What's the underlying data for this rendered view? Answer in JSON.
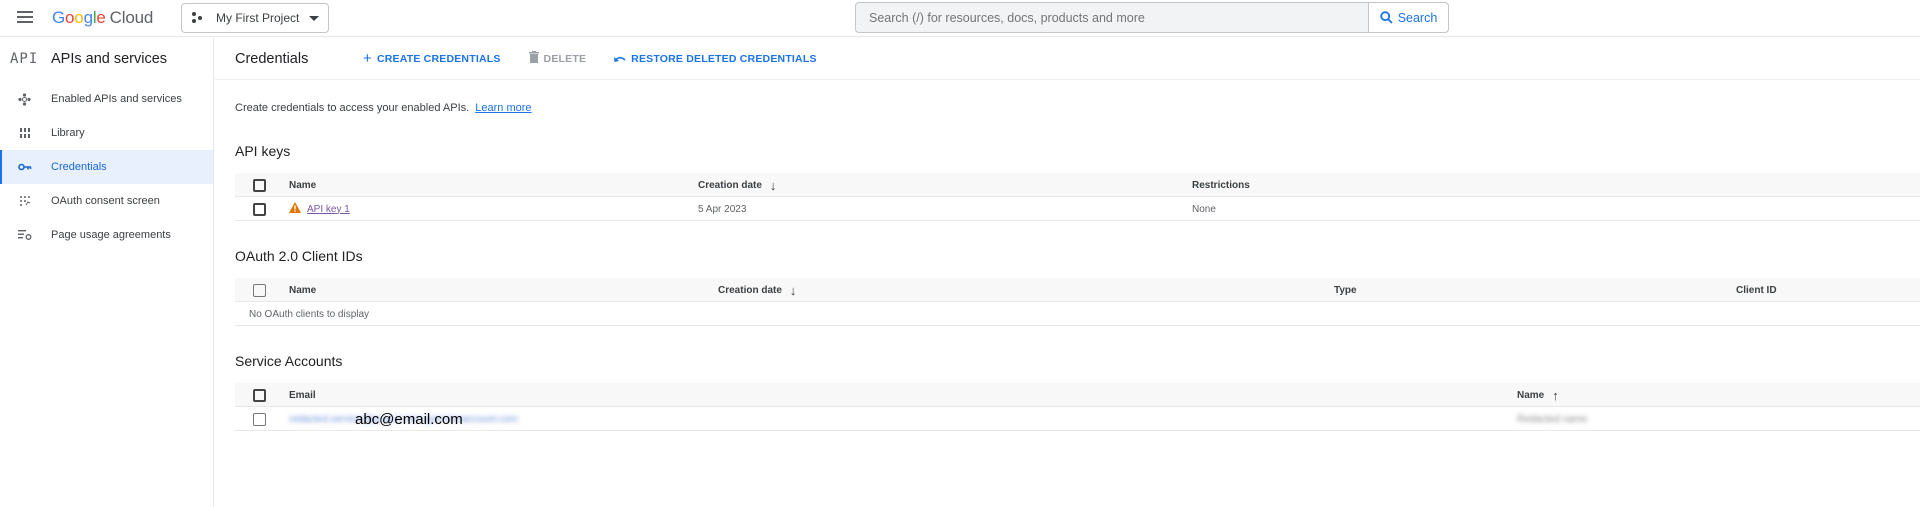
{
  "header": {
    "logo_letters": [
      "G",
      "o",
      "o",
      "g",
      "l",
      "e"
    ],
    "logo_product": "Cloud",
    "project_name": "My First Project",
    "search_placeholder": "Search (/) for resources, docs, products and more",
    "search_button": "Search"
  },
  "sidebar": {
    "badge": "API",
    "title": "APIs and services",
    "items": [
      {
        "label": "Enabled APIs and services",
        "icon": "enabled-apis-icon",
        "active": false
      },
      {
        "label": "Library",
        "icon": "library-icon",
        "active": false
      },
      {
        "label": "Credentials",
        "icon": "key-icon",
        "active": true
      },
      {
        "label": "OAuth consent screen",
        "icon": "oauth-consent-icon",
        "active": false
      },
      {
        "label": "Page usage agreements",
        "icon": "page-usage-icon",
        "active": false
      }
    ]
  },
  "main": {
    "title": "Credentials",
    "actions": {
      "create": "CREATE CREDENTIALS",
      "delete": "DELETE",
      "restore": "RESTORE DELETED CREDENTIALS"
    },
    "intro_text": "Create credentials to access your enabled APIs.",
    "learn_more": "Learn more",
    "api_keys": {
      "title": "API keys",
      "columns": [
        "Name",
        "Creation date",
        "Restrictions"
      ],
      "sort_column": "Creation date",
      "sort_direction": "descending",
      "rows": [
        {
          "name": "API key 1",
          "warning": true,
          "creation_date": "5 Apr 2023",
          "restrictions": "None"
        }
      ]
    },
    "oauth": {
      "title": "OAuth 2.0 Client IDs",
      "columns": [
        "Name",
        "Creation date",
        "Type",
        "Client ID"
      ],
      "sort_column": "Creation date",
      "sort_direction": "descending",
      "empty_message": "No OAuth clients to display"
    },
    "service_accounts": {
      "title": "Service Accounts",
      "columns": [
        "Email",
        "Name"
      ],
      "sort_column": "Name",
      "sort_direction": "ascending",
      "rows": [
        {
          "email_redacted": "redacted.service@project.iam.gserviceaccount.com",
          "email_overlay": "abc@email.com",
          "name_redacted": "Redacted name"
        }
      ]
    }
  },
  "colors": {
    "accent": "#1a73e8",
    "active_bg": "#e8f0fe",
    "warning": "#e37400",
    "visited_link": "#7b57a8"
  }
}
